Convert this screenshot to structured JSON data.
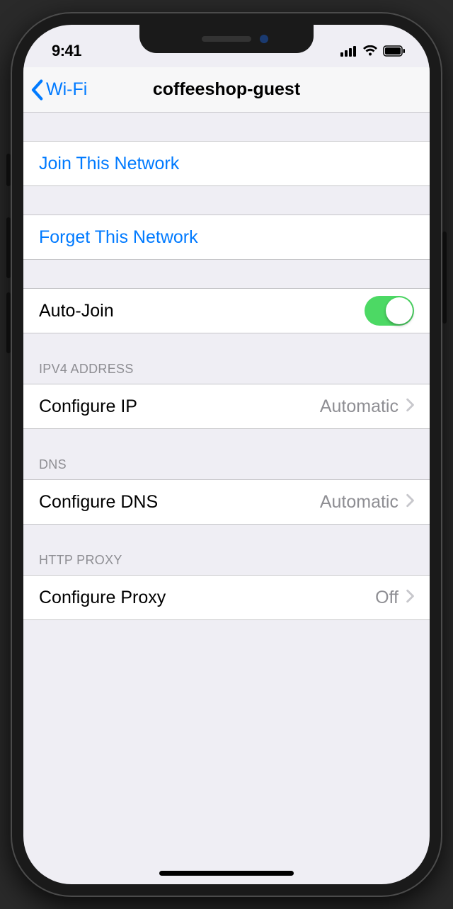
{
  "statusbar": {
    "time": "9:41"
  },
  "nav": {
    "back_label": "Wi-Fi",
    "title": "coffeeshop-guest"
  },
  "groups": {
    "join": {
      "label": "Join This Network"
    },
    "forget": {
      "label": "Forget This Network"
    },
    "autojoin": {
      "label": "Auto-Join",
      "on": true
    },
    "ipv4": {
      "header": "IPV4 ADDRESS",
      "configure_ip_label": "Configure IP",
      "configure_ip_value": "Automatic"
    },
    "dns": {
      "header": "DNS",
      "configure_dns_label": "Configure DNS",
      "configure_dns_value": "Automatic"
    },
    "proxy": {
      "header": "HTTP PROXY",
      "configure_proxy_label": "Configure Proxy",
      "configure_proxy_value": "Off"
    }
  }
}
